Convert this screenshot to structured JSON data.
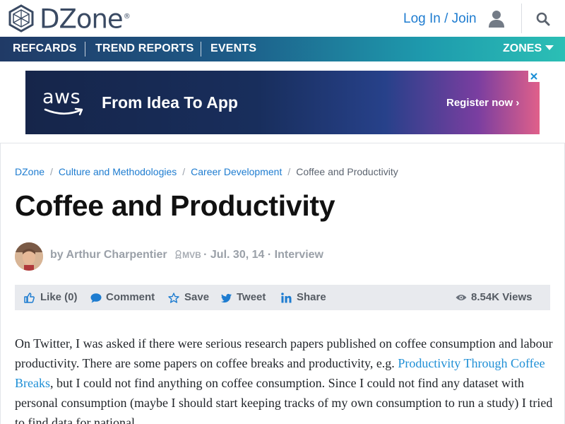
{
  "header": {
    "logo_text": "DZone",
    "logo_reg": "®",
    "login_label": "Log In / Join",
    "user_icon": "user-icon",
    "search_icon": "search-icon"
  },
  "nav": {
    "items": [
      {
        "label": "REFCARDS"
      },
      {
        "label": "TREND REPORTS"
      },
      {
        "label": "EVENTS"
      }
    ],
    "zones_label": "ZONES"
  },
  "ad": {
    "brand": "aws",
    "headline": "From Idea To App",
    "cta": "Register now ›"
  },
  "breadcrumb": {
    "items": [
      "DZone",
      "Culture and Methodologies",
      "Career Development"
    ],
    "current": "Coffee and Productivity"
  },
  "article": {
    "title": "Coffee and Productivity",
    "byline_prefix": "by",
    "author": "Arthur Charpentier",
    "badge": "MVB",
    "date": "Jul. 30, 14",
    "category": "Interview",
    "meta_sep": "·"
  },
  "actions": {
    "like": "Like (0)",
    "comment": "Comment",
    "save": "Save",
    "tweet": "Tweet",
    "share": "Share",
    "views": "8.54K Views"
  },
  "body": {
    "p1_part1": "On Twitter, I was asked if there were serious research papers published on coffee consumption and labour productivity. There are some papers on coffee breaks and productivity, e.g. ",
    "p1_link": "Productivity Through Coffee Breaks",
    "p1_part2": ", but I could not find anything on coffee consumption. Since I could not find any dataset with personal consumption (maybe I should start keeping tracks of my own consumption to run a study) I tried to find data for national"
  },
  "colors": {
    "link_blue": "#1e7cd0",
    "nav_gradient_start": "#203a66",
    "nav_gradient_end": "#2bbfb5",
    "action_bar_bg": "#e8eaee"
  }
}
